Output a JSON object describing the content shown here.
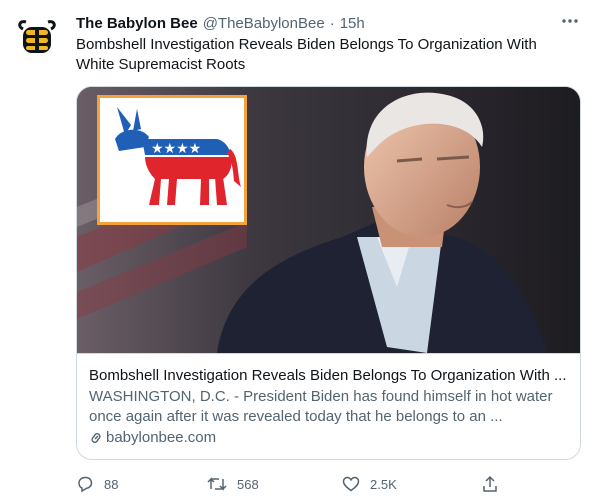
{
  "tweet": {
    "author_name": "The Babylon Bee",
    "handle": "@TheBabylonBee",
    "separator": "·",
    "time": "15h",
    "text": "Bombshell Investigation Reveals Biden Belongs To Organization With White Supremacist Roots"
  },
  "card": {
    "title": "Bombshell Investigation Reveals Biden Belongs To Organization With ...",
    "description": "WASHINGTON, D.C. - President Biden has found himself in hot water once again after it was revealed today that he belongs to an ...",
    "domain": "babylonbee.com"
  },
  "actions": {
    "replies": "88",
    "retweets": "568",
    "likes": "2.5K"
  },
  "colors": {
    "text": "#0f1419",
    "secondary": "#536471",
    "border": "#cfd9de",
    "logo_frame": "#f2a33a",
    "donkey_blue": "#1f5fb5",
    "donkey_red": "#e0252c"
  },
  "icons": [
    "babylon-bee-logo",
    "more-icon",
    "link-icon",
    "reply-icon",
    "retweet-icon",
    "like-icon",
    "share-icon"
  ]
}
